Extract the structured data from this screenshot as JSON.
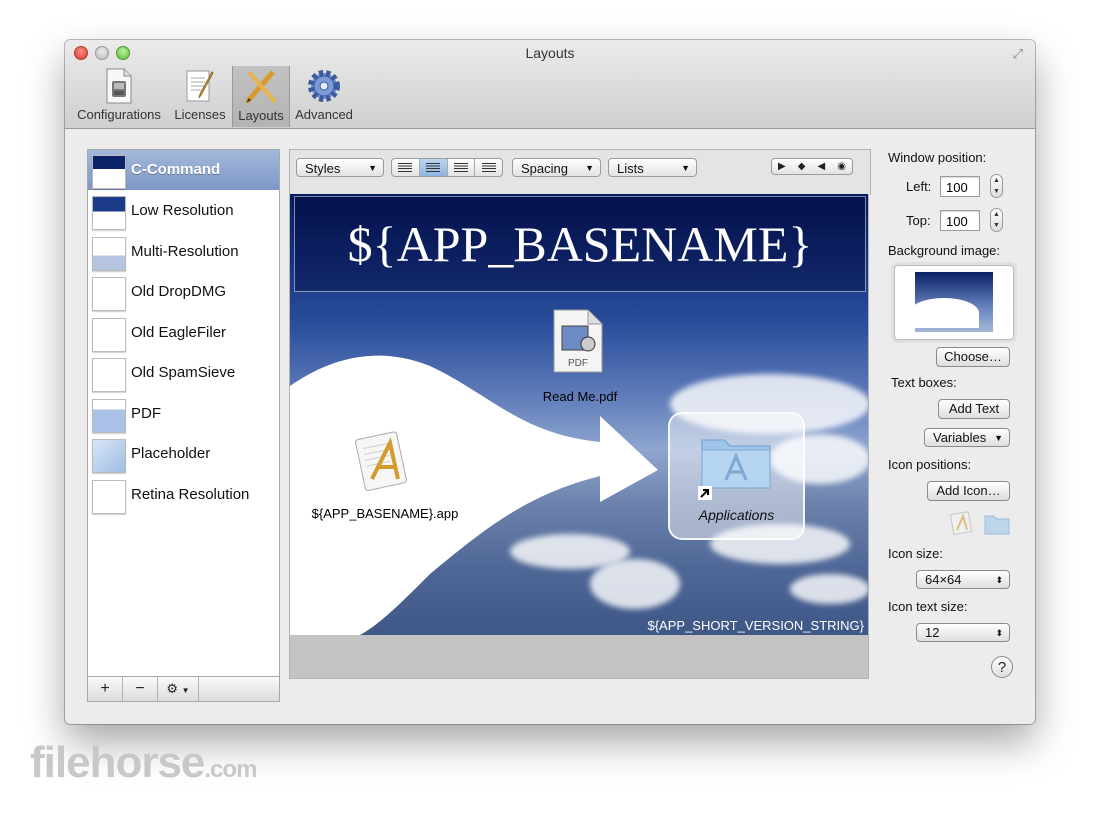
{
  "window": {
    "title": "Layouts"
  },
  "toolbar": {
    "items": [
      {
        "label": "Configurations"
      },
      {
        "label": "Licenses"
      },
      {
        "label": "Layouts"
      },
      {
        "label": "Advanced"
      }
    ],
    "selected": "Layouts"
  },
  "layouts": {
    "items": [
      {
        "label": "C-Command"
      },
      {
        "label": "Low Resolution"
      },
      {
        "label": "Multi-Resolution"
      },
      {
        "label": "Old DropDMG"
      },
      {
        "label": "Old EagleFiler"
      },
      {
        "label": "Old SpamSieve"
      },
      {
        "label": "PDF"
      },
      {
        "label": "Placeholder"
      },
      {
        "label": "Retina Resolution"
      }
    ],
    "selected": "C-Command",
    "footer": {
      "add": "+",
      "remove": "−",
      "gear": "⚙"
    }
  },
  "editor": {
    "styles_label": "Styles",
    "spacing_label": "Spacing",
    "lists_label": "Lists",
    "alignment_selected": "center"
  },
  "canvas": {
    "title": "${APP_BASENAME}",
    "pdf_label": "Read Me.pdf",
    "pdf_badge": "PDF",
    "app_label": "${APP_BASENAME}.app",
    "apps_label": "Applications",
    "version": "${APP_SHORT_VERSION_STRING}"
  },
  "inspector": {
    "window_position_label": "Window position:",
    "left_label": "Left:",
    "left_value": "100",
    "top_label": "Top:",
    "top_value": "100",
    "background_image_label": "Background image:",
    "choose_button": "Choose…",
    "text_boxes_label": "Text boxes:",
    "add_text_button": "Add Text",
    "variables_label": "Variables",
    "icon_positions_label": "Icon positions:",
    "add_icon_button": "Add Icon…",
    "icon_size_label": "Icon size:",
    "icon_size_value": "64×64",
    "icon_text_size_label": "Icon text size:",
    "icon_text_size_value": "12",
    "help": "?"
  },
  "watermark": {
    "text": "filehorse",
    "suffix": ".com"
  }
}
